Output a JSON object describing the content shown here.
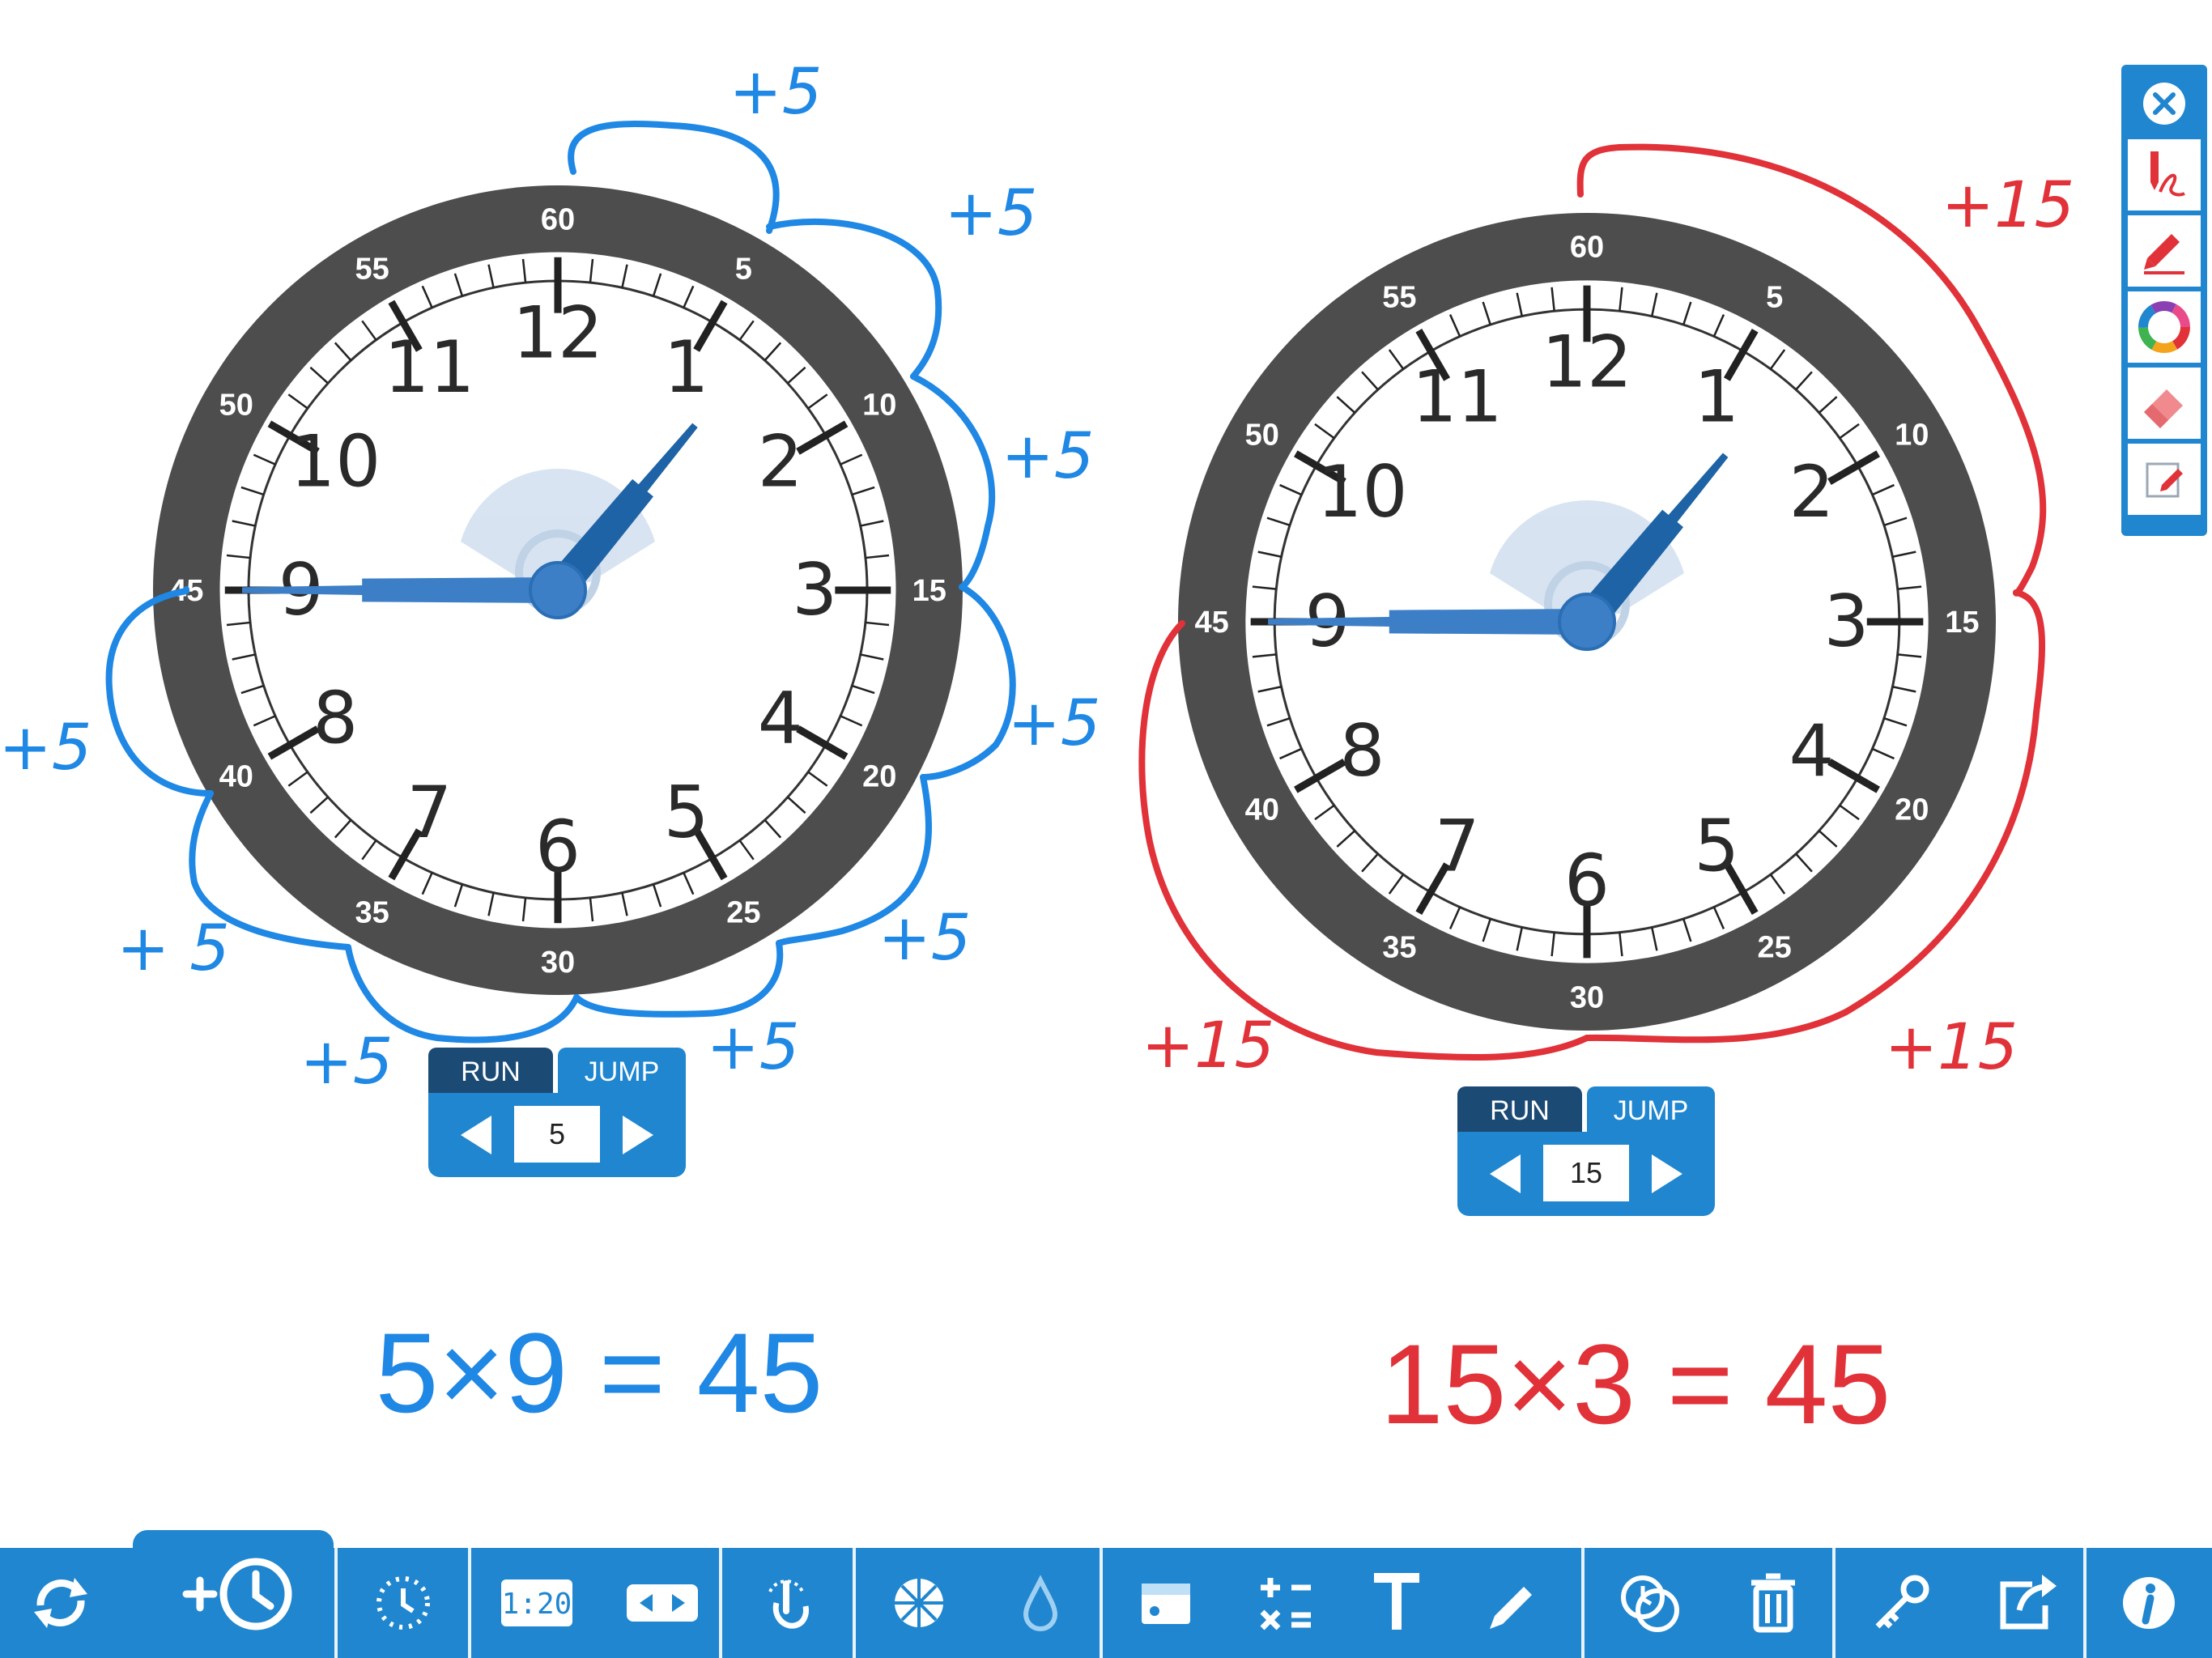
{
  "clocks": [
    {
      "id": "left",
      "hour_numbers": [
        "12",
        "1",
        "2",
        "3",
        "4",
        "5",
        "6",
        "7",
        "8",
        "9",
        "10",
        "11"
      ],
      "minute_labels": [
        "60",
        "5",
        "10",
        "15",
        "20",
        "25",
        "30",
        "35",
        "40",
        "45",
        "50",
        "55"
      ],
      "hour_hand_points_to": 1,
      "minute_hand_points_to_minute": 45,
      "control": {
        "run_label": "RUN",
        "jump_label": "JUMP",
        "value": "5"
      },
      "annotation_color": "#1f87e4",
      "annotation_labels": [
        "+5",
        "+5",
        "+5",
        "+5",
        "+5",
        "+5",
        "+5",
        "+ 5",
        "+5"
      ]
    },
    {
      "id": "right",
      "hour_numbers": [
        "12",
        "1",
        "2",
        "3",
        "4",
        "5",
        "6",
        "7",
        "8",
        "9",
        "10",
        "11"
      ],
      "minute_labels": [
        "60",
        "5",
        "10",
        "15",
        "20",
        "25",
        "30",
        "35",
        "40",
        "45",
        "50",
        "55"
      ],
      "hour_hand_points_to": 1,
      "minute_hand_points_to_minute": 45,
      "control": {
        "run_label": "RUN",
        "jump_label": "JUMP",
        "value": "15"
      },
      "annotation_color": "#e03238",
      "annotation_labels": [
        "+15",
        "+15",
        "+15"
      ]
    }
  ],
  "equations": [
    {
      "text": "5×9 = 45",
      "color": "#1f87e4"
    },
    {
      "text": "15×3 = 45",
      "color": "#e03238"
    }
  ],
  "palette": {
    "items": [
      "close-icon",
      "pen-icon",
      "highlighter-icon",
      "color-wheel-icon",
      "eraser-icon",
      "notes-icon"
    ]
  },
  "toolbar": {
    "items": [
      "reset-icon",
      "add-clock-icon",
      "clock-face-icon",
      "digital-time-icon",
      "toggle-view-icon",
      "touch-icon",
      "segment-wheel-icon",
      "drop-icon",
      "display-box-icon",
      "math-symbols-icon",
      "text-icon",
      "pencil-icon",
      "time-compare-icon",
      "trash-icon",
      "key-icon",
      "share-icon",
      "info-icon"
    ],
    "digital_readout": "1:20"
  },
  "colors": {
    "accent": "#1f86cf",
    "accent_dark": "#1b4a74",
    "bezel": "#4d4d4d",
    "hand": "#3d7fc6",
    "hand_dark": "#1e63a5",
    "blue_ink": "#1f87e4",
    "red_ink": "#e03238"
  }
}
